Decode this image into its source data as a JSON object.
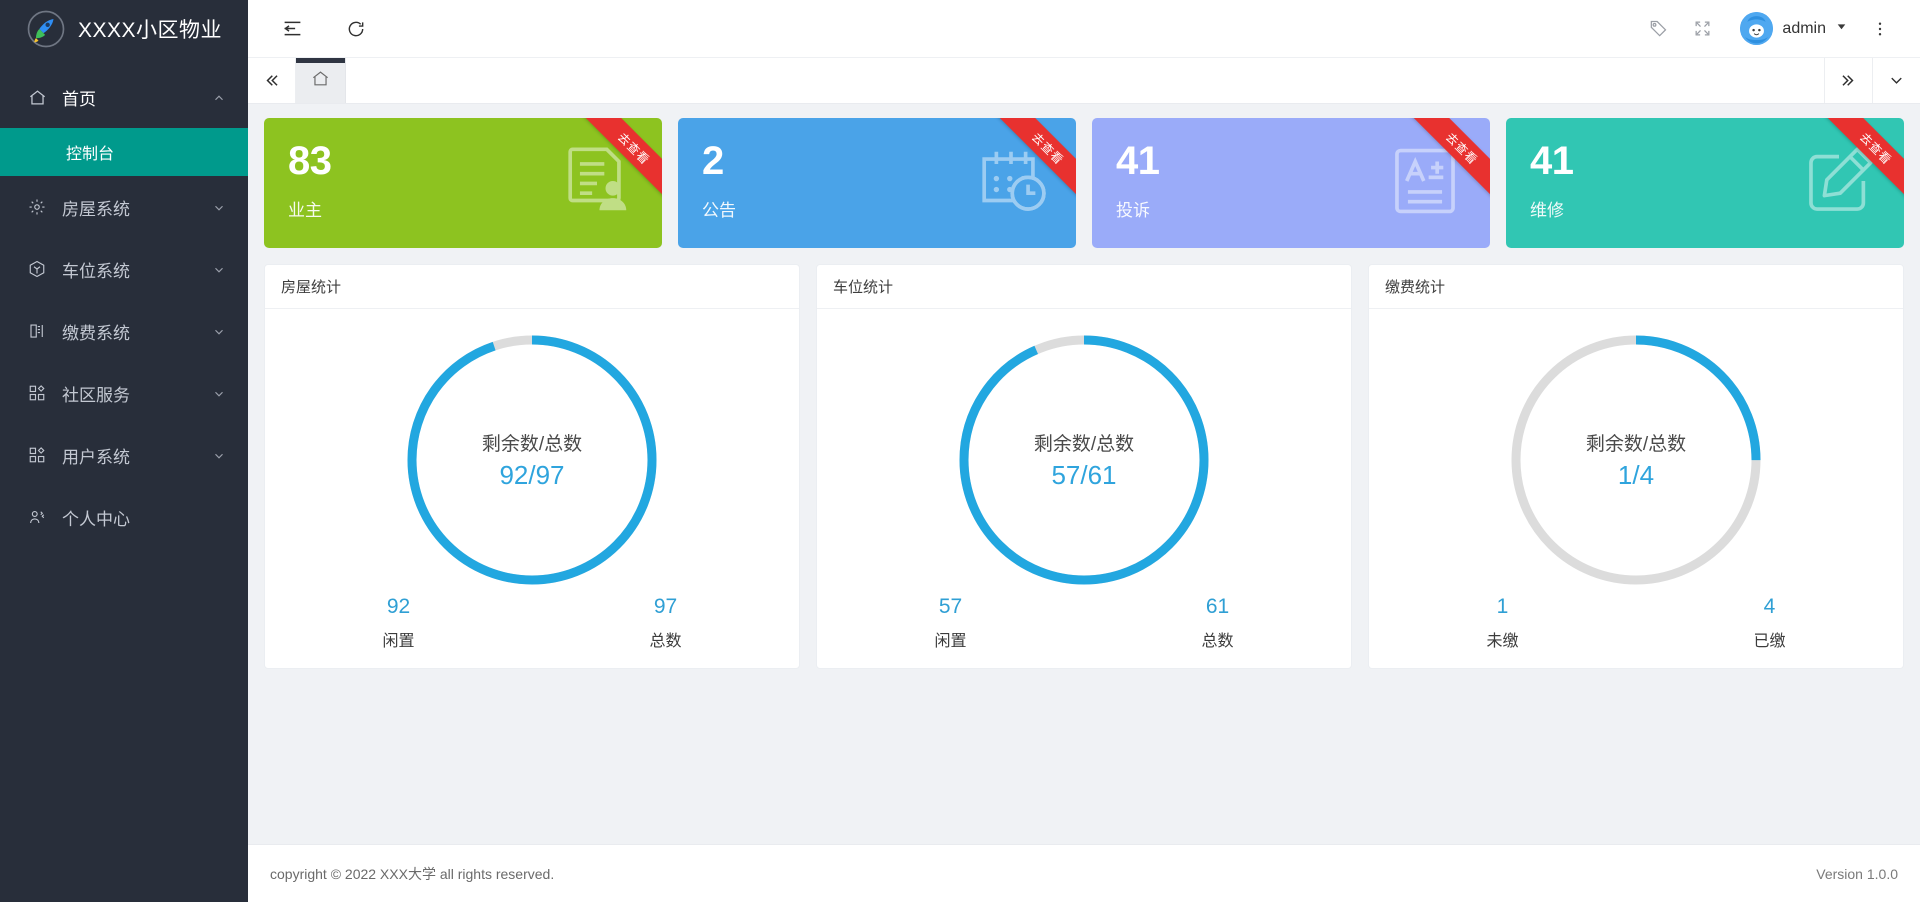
{
  "brand": {
    "title": "XXXX小区物业",
    "logo_icon": "rocket-logo-icon"
  },
  "sidebar": {
    "home": {
      "label": "首页",
      "icon": "home-icon",
      "arrow_icon": "chevron-up-icon"
    },
    "submenu": [
      {
        "label": "控制台",
        "active": true
      }
    ],
    "items": [
      {
        "label": "房屋系统",
        "icon": "gear-icon",
        "arrow_icon": "chevron-down-icon"
      },
      {
        "label": "车位系统",
        "icon": "cube-icon",
        "arrow_icon": "chevron-down-icon"
      },
      {
        "label": "缴费系统",
        "icon": "book-icon",
        "arrow_icon": "chevron-down-icon"
      },
      {
        "label": "社区服务",
        "icon": "grid-icon",
        "arrow_icon": "chevron-down-icon"
      },
      {
        "label": "用户系统",
        "icon": "grid-icon",
        "arrow_icon": "chevron-down-icon"
      },
      {
        "label": "个人中心",
        "icon": "user-settings-icon",
        "arrow_icon": ""
      }
    ]
  },
  "topbar": {
    "collapse_icon": "menu-fold-icon",
    "refresh_icon": "refresh-icon",
    "tag_icon": "tag-icon",
    "fullscreen_icon": "fullscreen-icon",
    "avatar_icon": "avatar-icon",
    "user_name": "admin",
    "user_caret_icon": "caret-down-icon",
    "more_icon": "more-vertical-icon"
  },
  "tabbar": {
    "prev_icon": "double-chevron-left-icon",
    "next_icon": "double-chevron-right-icon",
    "dropdown_icon": "chevron-down-icon",
    "tabs": [
      {
        "icon": "home-icon",
        "label": "",
        "active": true
      }
    ]
  },
  "stats": {
    "ribbon_text": "去查看",
    "cards": [
      {
        "value": "83",
        "label": "业主",
        "color": "#8dc320",
        "icon": "owner-document-icon"
      },
      {
        "value": "2",
        "label": "公告",
        "color": "#4aa3e8",
        "icon": "calendar-clock-icon"
      },
      {
        "value": "41",
        "label": "投诉",
        "color": "#9aabf9",
        "icon": "grade-document-icon"
      },
      {
        "value": "41",
        "label": "维修",
        "color": "#31c6b3",
        "icon": "edit-pencil-icon"
      }
    ]
  },
  "chart_data": [
    {
      "type": "pie",
      "title": "房屋统计",
      "center_title": "剩余数/总数",
      "center_value": "92/97",
      "categories": [
        "闲置",
        "总数"
      ],
      "values": [
        92,
        97
      ],
      "ratio": 0.9485,
      "arc_color": "#22a7e0",
      "track_color": "#dcdcdc",
      "legend": [
        {
          "num": "92",
          "label": "闲置"
        },
        {
          "num": "97",
          "label": "总数"
        }
      ]
    },
    {
      "type": "pie",
      "title": "车位统计",
      "center_title": "剩余数/总数",
      "center_value": "57/61",
      "categories": [
        "闲置",
        "总数"
      ],
      "values": [
        57,
        61
      ],
      "ratio": 0.9344,
      "arc_color": "#22a7e0",
      "track_color": "#dcdcdc",
      "legend": [
        {
          "num": "57",
          "label": "闲置"
        },
        {
          "num": "61",
          "label": "总数"
        }
      ]
    },
    {
      "type": "pie",
      "title": "缴费统计",
      "center_title": "剩余数/总数",
      "center_value": "1/4",
      "categories": [
        "未缴",
        "已缴"
      ],
      "values": [
        1,
        4
      ],
      "ratio": 0.25,
      "arc_color": "#22a7e0",
      "track_color": "#dcdcdc",
      "legend": [
        {
          "num": "1",
          "label": "未缴"
        },
        {
          "num": "4",
          "label": "已缴"
        }
      ]
    }
  ],
  "footer": {
    "copyright": "copyright © 2022 XXX大学 all rights reserved.",
    "version": "Version 1.0.0"
  }
}
